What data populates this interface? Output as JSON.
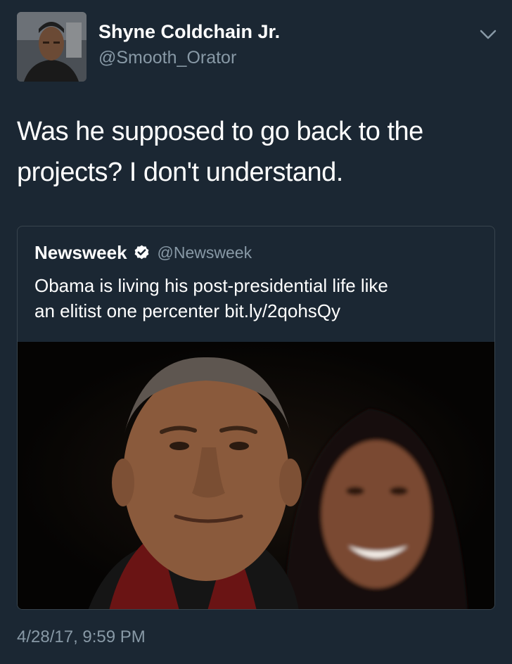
{
  "author": {
    "display_name": "Shyne Coldchain Jr.",
    "handle": "@Smooth_Orator",
    "avatar_icon": "profile-photo"
  },
  "menu": {
    "icon": "chevron-down-icon"
  },
  "tweet": {
    "line1": "Was he supposed to go back to the",
    "line2": "projects? I don't understand.",
    "timestamp": "4/28/17, 9:59 PM"
  },
  "quoted": {
    "display_name": "Newsweek",
    "verified": true,
    "verified_icon": "verified-badge-icon",
    "handle": "@Newsweek",
    "line1": "Obama is living his post-presidential life like",
    "line2": "an elitist one percenter bit.ly/2qohsQy",
    "media": "photo"
  },
  "colors": {
    "background": "#1b2733",
    "secondary_text": "#8899a6",
    "card_border": "#38444d"
  }
}
